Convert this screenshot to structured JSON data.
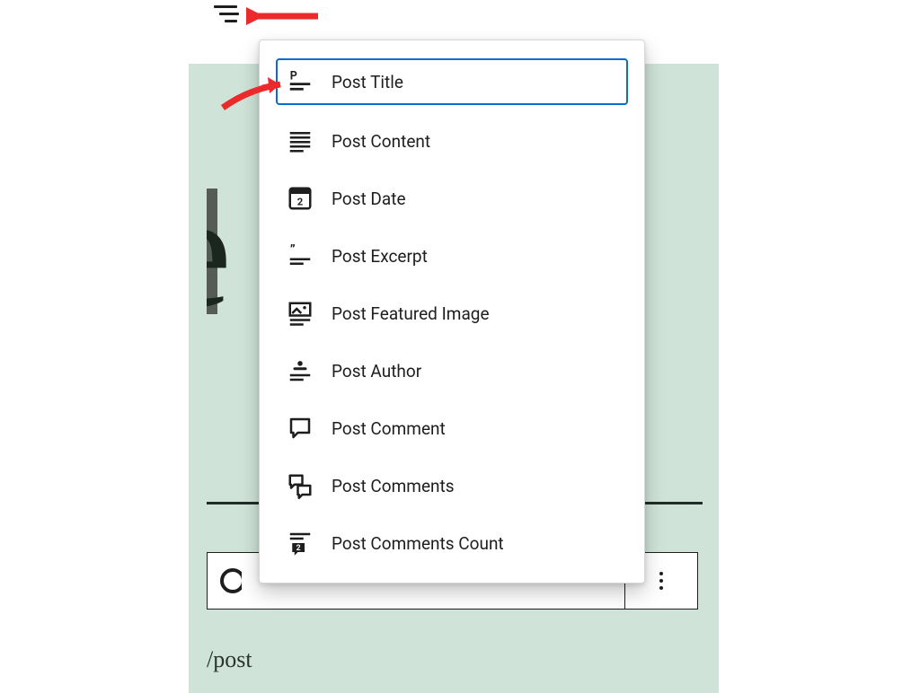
{
  "editor": {
    "big_title_fragment": "le",
    "slash_command": "/post"
  },
  "menu": {
    "items": [
      {
        "label": "Post Title",
        "icon": "post-title-icon",
        "selected": true
      },
      {
        "label": "Post Content",
        "icon": "post-content-icon",
        "selected": false
      },
      {
        "label": "Post Date",
        "icon": "post-date-icon",
        "selected": false
      },
      {
        "label": "Post Excerpt",
        "icon": "post-excerpt-icon",
        "selected": false
      },
      {
        "label": "Post Featured Image",
        "icon": "post-featured-image-icon",
        "selected": false
      },
      {
        "label": "Post Author",
        "icon": "post-author-icon",
        "selected": false
      },
      {
        "label": "Post Comment",
        "icon": "post-comment-icon",
        "selected": false
      },
      {
        "label": "Post Comments",
        "icon": "post-comments-icon",
        "selected": false
      },
      {
        "label": "Post Comments Count",
        "icon": "post-comments-count-icon",
        "selected": false
      }
    ]
  },
  "colors": {
    "teal_bg": "#cfe3d8",
    "selection_blue": "#0a6bd1",
    "annotation_red": "#ec2a2b"
  }
}
